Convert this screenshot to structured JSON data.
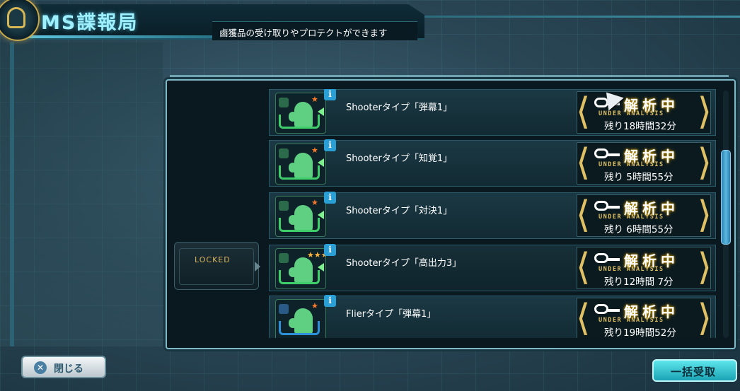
{
  "header": {
    "title": "MS諜報局",
    "subtitle": "鹵獲品の受け取りやプロテクトができます"
  },
  "list": {
    "items": [
      {
        "name": "Shooterタイプ「弾幕1」",
        "status": "解析中",
        "status_en": "UNDER ANALYSIS",
        "remaining": "残り18時間32分",
        "stars": "★",
        "frame": "green"
      },
      {
        "name": "Shooterタイプ「知覚1」",
        "status": "解析中",
        "status_en": "UNDER ANALYSIS",
        "remaining": "残り 5時間55分",
        "stars": "★",
        "frame": "green"
      },
      {
        "name": "Shooterタイプ「対決1」",
        "status": "解析中",
        "status_en": "UNDER ANALYSIS",
        "remaining": "残り 6時間55分",
        "stars": "★",
        "frame": "green"
      },
      {
        "name": "Shooterタイプ「高出力3」",
        "status": "解析中",
        "status_en": "UNDER ANALYSIS",
        "remaining": "残り12時間 7分",
        "stars": "★★★",
        "frame": "green"
      },
      {
        "name": "Flierタイプ「弾幕1」",
        "status": "解析中",
        "status_en": "UNDER ANALYSIS",
        "remaining": "残り19時間52分",
        "stars": "★",
        "frame": "blue"
      }
    ],
    "info_label": "i"
  },
  "locked_tab": {
    "label": "LOCKED"
  },
  "buttons": {
    "close_label": "閉じる",
    "close_icon": "✕",
    "bulk_receive_label": "一括受取"
  },
  "colors": {
    "accent": "#9ff0ff",
    "gold": "#e0c064",
    "info": "#2a9fd6"
  }
}
